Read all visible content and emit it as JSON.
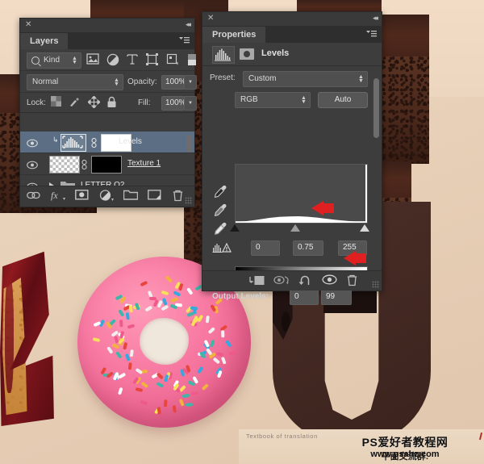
{
  "app": "Adobe Photoshop",
  "layers_panel": {
    "tab_label": "Layers",
    "close_icon": "close-icon",
    "collapse_icon": "collapse-icon",
    "menu_icon": "panel-menu-icon",
    "filter": {
      "kind_label": "Kind",
      "icons": [
        "pixel-filter-icon",
        "adjustment-filter-icon",
        "type-filter-icon",
        "shape-filter-icon",
        "smart-object-filter-icon",
        "filter-toggle-icon"
      ]
    },
    "blend": {
      "mode": "Normal",
      "opacity_label": "Opacity:",
      "opacity_value": "100%"
    },
    "lock": {
      "label": "Lock:",
      "icons": [
        "lock-transparency-icon",
        "lock-image-icon",
        "lock-position-icon",
        "lock-all-icon"
      ],
      "fill_label": "Fill:",
      "fill_value": "100%"
    },
    "rows": [
      {
        "name": "Levels",
        "visible": true,
        "selected": true,
        "thumb": "white-adjustment-thumb"
      },
      {
        "name": "Texture 1",
        "visible": true,
        "selected": false,
        "thumb": "transparent-checker-thumb"
      },
      {
        "name": "LETTER O2",
        "visible": true,
        "selected": false,
        "thumb": "folder-thumb"
      }
    ],
    "footer_icons": [
      "link-layers-icon",
      "layer-style-fx-icon",
      "add-mask-icon",
      "new-adjustment-icon",
      "new-group-icon",
      "new-layer-icon",
      "delete-layer-icon"
    ]
  },
  "properties_panel": {
    "tab_label": "Properties",
    "close_icon": "close-icon",
    "collapse_icon": "collapse-icon",
    "menu_icon": "panel-menu-icon",
    "adjustment_title": "Levels",
    "adjustment_icon": "levels-icon",
    "mask_icon": "mask-icon",
    "preset_label": "Preset:",
    "preset_value": "Custom",
    "channel_value": "RGB",
    "auto_label": "Auto",
    "eyedroppers": [
      "black-point-eyedropper",
      "gray-point-eyedropper",
      "white-point-eyedropper"
    ],
    "input_levels": {
      "black": "0",
      "gamma": "0.75",
      "white": "255"
    },
    "output_levels": {
      "label": "Output Levels:",
      "black": "0",
      "white": "99"
    },
    "footer_icons": [
      "clip-to-layer-icon",
      "toggle-previous-state-icon",
      "reset-icon",
      "toggle-visibility-icon",
      "delete-icon"
    ]
  },
  "annotations": {
    "arrow_color": "#e02020",
    "arrows": [
      "gamma-arrow",
      "output-white-arrow"
    ]
  },
  "canvas": {
    "caption": "Textbook of translation",
    "watermark_line1": "PS爱好者教程网",
    "watermark_cn": "平面交流群:",
    "watermark_url": "www.psahz.com",
    "background_color": "#e8d4bd",
    "donut_color": "#f2769e",
    "letter_u_color": "#4c2f28",
    "jam_color": "#8e1a1f"
  }
}
